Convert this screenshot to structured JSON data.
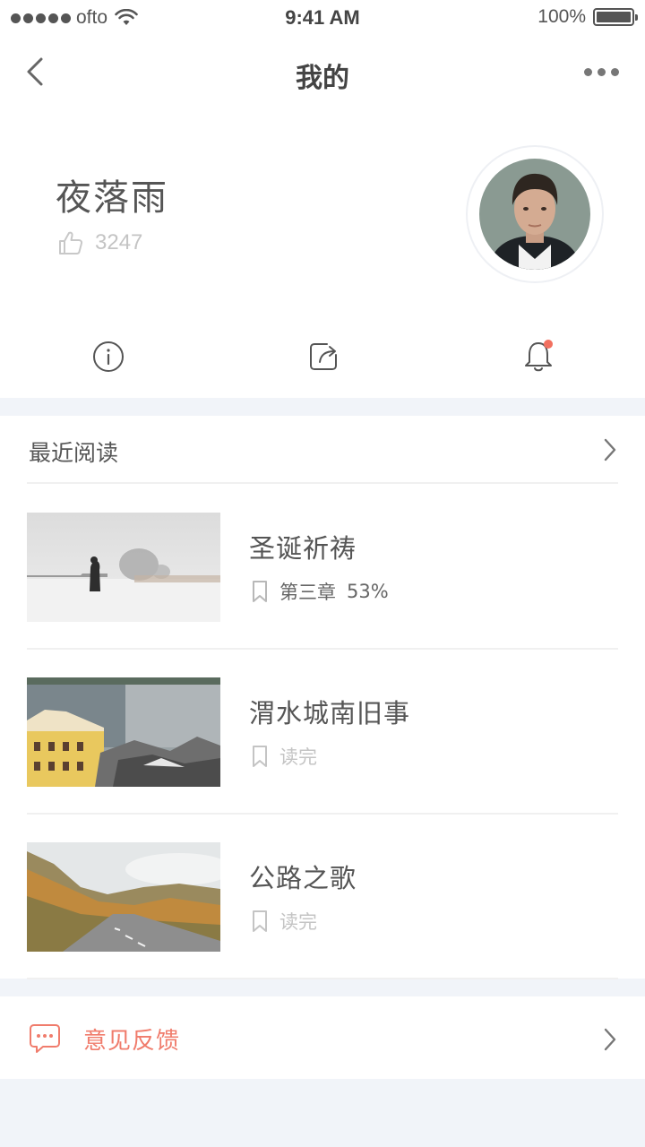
{
  "status_bar": {
    "carrier": "ofto",
    "time": "9:41 AM",
    "battery": "100%"
  },
  "nav": {
    "title": "我的"
  },
  "profile": {
    "name": "夜落雨",
    "likes": "3247"
  },
  "recent": {
    "title": "最近阅读",
    "books": [
      {
        "title": "圣诞祈祷",
        "chapter": "第三章",
        "progress": "53%"
      },
      {
        "title": "渭水城南旧事",
        "status": "读完"
      },
      {
        "title": "公路之歌",
        "status": "读完"
      }
    ]
  },
  "feedback": {
    "label": "意见反馈"
  },
  "colors": {
    "accent": "#f07c6c",
    "background": "#f1f4f9",
    "notification_dot": "#f2705f"
  }
}
